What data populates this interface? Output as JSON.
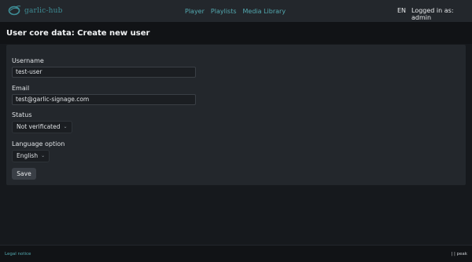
{
  "header": {
    "logo_text": "garlic-hub",
    "nav": [
      "Player",
      "Playlists",
      "Media Library"
    ],
    "language": "EN",
    "user_status": "Logged in as: admin"
  },
  "page": {
    "title": "User core data: Create new user"
  },
  "form": {
    "username_label": "Username",
    "username_value": "test-user",
    "email_label": "Email",
    "email_value": "test@garlic-signage.com",
    "status_label": "Status",
    "status_value": "Not verificated",
    "language_label": "Language option",
    "language_value": "English",
    "save_label": "Save"
  },
  "footer": {
    "legal": "Legal notice",
    "build": "| | peak"
  },
  "colors": {
    "accent": "#53a9b0",
    "background": "#16191d",
    "panel": "#23272c"
  }
}
